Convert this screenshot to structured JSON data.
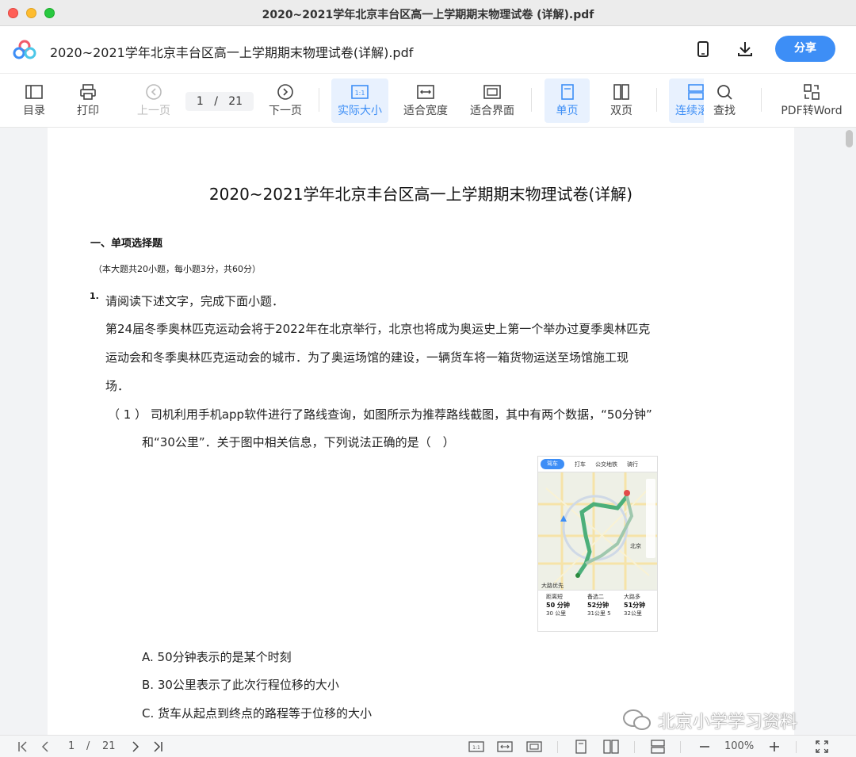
{
  "window": {
    "title": "2020~2021学年北京丰台区高一上学期期末物理试卷 (详解).pdf"
  },
  "header": {
    "doc_title": "2020~2021学年北京丰台区高一上学期期末物理试卷(详解).pdf",
    "share_label": "分享",
    "icons": [
      "phone-icon",
      "download-icon"
    ]
  },
  "toolbar": {
    "toc": "目录",
    "print": "打印",
    "prev": "上一页",
    "page_current": "1",
    "page_sep": "/",
    "page_total": "21",
    "next": "下一页",
    "actual_size": "实际大小",
    "fit_width": "适合宽度",
    "fit_page": "适合界面",
    "single": "单页",
    "double": "双页",
    "continuous": "连续滚",
    "find": "查找",
    "pdf_to_word": "PDF转Word",
    "accent": "#3d8ef6"
  },
  "document": {
    "heading": "2020~2021学年北京丰台区高一上学期期末物理试卷(详解)",
    "section_title": "一、单项选择题",
    "section_sub": "（本大题共20小题，每小题3分，共60分）",
    "q_number": "1.",
    "lines": [
      "请阅读下述文字，完成下面小题．",
      "第24届冬季奥林匹克运动会将于2022年在北京举行，北京也将成为奥运史上第一个举办过夏季奥林匹克",
      "运动会和冬季奥林匹克运动会的城市．为了奥运场馆的建设，一辆货车将一箱货物运送至场馆施工现",
      "场．",
      "（ 1 ）  司机利用手机app软件进行了路线查询，如图所示为推荐路线截图，其中有两个数据，“50分钟”",
      "和“30公里”．关于图中相关信息，下列说法正确的是（　）"
    ],
    "options": [
      "A. 50分钟表示的是某个时刻",
      "B. 30公里表示了此次行程位移的大小",
      "C. 货车从起点到终点的路程等于位移的大小"
    ],
    "map": {
      "tabs": [
        "驾车",
        "打车",
        "公交地铁",
        "骑行"
      ],
      "city_label": "北京",
      "route_info": [
        {
          "head": "距离短",
          "time": "50 分钟",
          "dist": "30 公里"
        },
        {
          "head": "备选二",
          "time": "52分钟",
          "dist": "31公里 5"
        },
        {
          "head": "大路多",
          "time": "51分钟",
          "dist": "32公里"
        }
      ],
      "start_label": "大路优先"
    }
  },
  "watermark": "北京小学学习资料",
  "statusbar": {
    "page_current": "1",
    "page_sep": "/",
    "page_total": "21",
    "zoom": "100%"
  }
}
